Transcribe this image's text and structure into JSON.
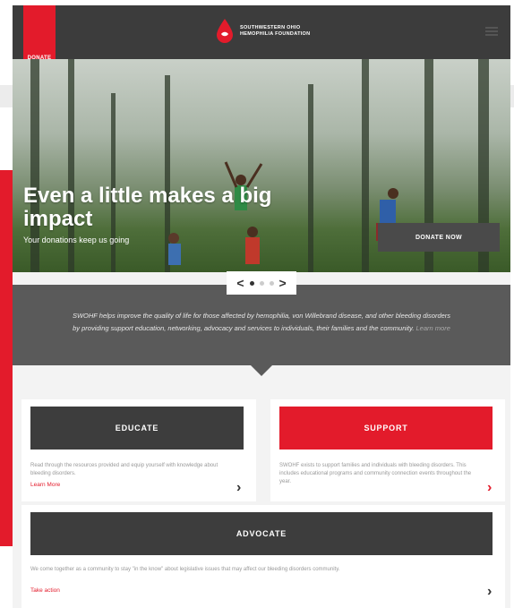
{
  "header": {
    "donate_label": "DONATE",
    "logo_line1": "SOUTHWESTERN OHIO",
    "logo_line2": "HEMOPHILIA FOUNDATION"
  },
  "hero": {
    "title_line1": "Even a little makes a big",
    "title_line2": "impact",
    "subtitle": "Your donations keep us going",
    "button_label": "DONATE NOW"
  },
  "slider": {
    "prev": "<",
    "next": ">"
  },
  "mission": {
    "text": "SWOHF helps improve the quality of life for those affected by hemophilia, von Willebrand disease, and other bleeding disorders by providing support education, networking, advocacy and services to individuals, their families and the community.",
    "learn_more": "Learn more"
  },
  "cards": {
    "educate": {
      "title": "EDUCATE",
      "text": "Read through the resources provided and equip yourself with knowledge about bleeding disorders.",
      "link": "Learn More"
    },
    "support": {
      "title": "SUPPORT",
      "text": "SWOHF exists to support families and individuals with bleeding disorders. This includes educational programs and community connection events throughout the year."
    },
    "advocate": {
      "title": "ADVOCATE",
      "text": "We come together as a community to stay \"in the know\" about legislative issues that may affect our bleeding disorders community.",
      "link": "Take action"
    }
  },
  "colors": {
    "brand_red": "#e31b2b",
    "dark_gray": "#3c3c3c",
    "band_gray": "#5a5a5a"
  }
}
